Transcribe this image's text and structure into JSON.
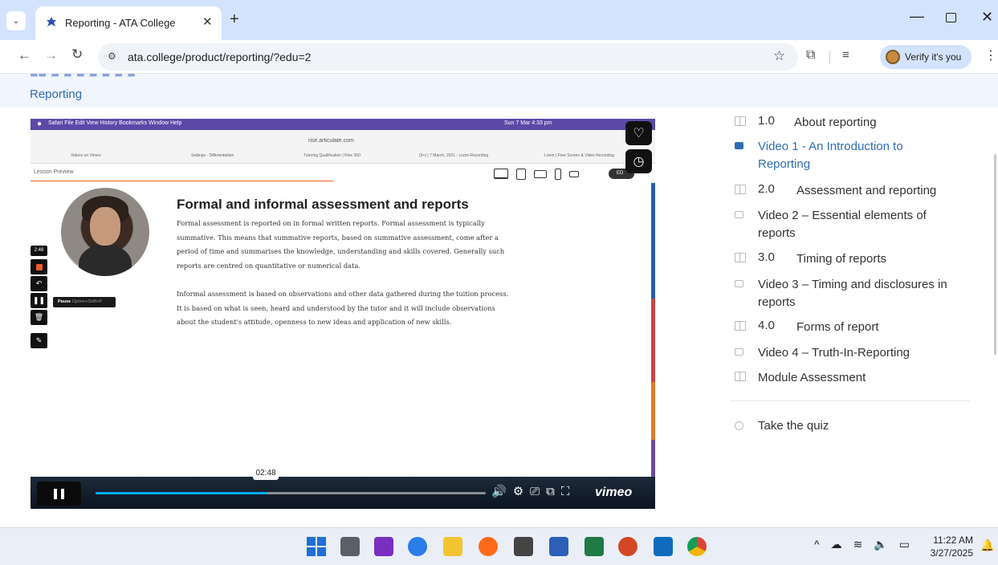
{
  "browser": {
    "tab_title": "Reporting - ATA College",
    "tab_close": "✕",
    "new_tab": "+",
    "url": "ata.college/product/reporting/?edu=2",
    "verify_label": "Verify it's you",
    "window_controls": {
      "minimize": "—",
      "close": "✕"
    }
  },
  "page": {
    "breadcrumb": "Reporting"
  },
  "video": {
    "mac_menu": "Safari   File   Edit   View   History   Bookmarks   Window   Help",
    "mac_status": "Sun 7 Mar  4:33 pm",
    "safari_url": "rise.articulate.com",
    "safari_tabs": [
      "Videos on Vimeo",
      "Settings - Differentiation",
      "Tutoring Qualification | Rise 360",
      "(9+) | 7 March, 2021 - Loom Recording",
      "Loom | Free Screen & Video Recording"
    ],
    "lesson_preview_label": "Lesson Preview",
    "edit_pill": "ED",
    "lesson_heading": "Formal and informal assessment and reports",
    "paragraph_1": "Formal assessment is reported on in formal written reports. Formal assessment is typically summative. This means that summative reports, based on summative assessment, come after a period of time and summarises the knowledge, understanding and skills covered. Generally such reports are centred on quantitative or numerical data.",
    "paragraph_2": "Informal assessment is based on observations and other data gathered during the tuition process. It is based on what is seen, heard and understood by the tutor and it will include observations about the student's attitude, openness to new ideas and application of new skills.",
    "recorder_time": "2:48",
    "pause_tooltip_label": "Pause",
    "pause_tooltip_shortcut": "Option+Shift+P",
    "player_time": "02:48",
    "progress": 0.44,
    "brand": "vimeo",
    "accent_color": "#00adef"
  },
  "sidebar": {
    "items": [
      {
        "num": "1.0",
        "label": "About reporting",
        "type": "lesson"
      },
      {
        "num": "",
        "label": "Video 1 - An Introduction to Reporting",
        "type": "video",
        "active": true
      },
      {
        "num": "2.0",
        "label": "Assessment and reporting",
        "type": "lesson"
      },
      {
        "num": "",
        "label": "Video 2 – Essential elements of reports",
        "type": "video"
      },
      {
        "num": "3.0",
        "label": "Timing of reports",
        "type": "lesson"
      },
      {
        "num": "",
        "label": "Video 3 – Timing and disclosures in reports",
        "type": "video"
      },
      {
        "num": "4.0",
        "label": "Forms of report",
        "type": "lesson"
      },
      {
        "num": "",
        "label": "Video 4 – Truth-In-Reporting",
        "type": "video"
      },
      {
        "num": "",
        "label": "Module Assessment",
        "type": "lesson"
      }
    ],
    "quiz_label": "Take the quiz",
    "active_color": "#2f6db3"
  },
  "taskbar": {
    "time": "11:22 AM",
    "date": "3/27/2025"
  }
}
